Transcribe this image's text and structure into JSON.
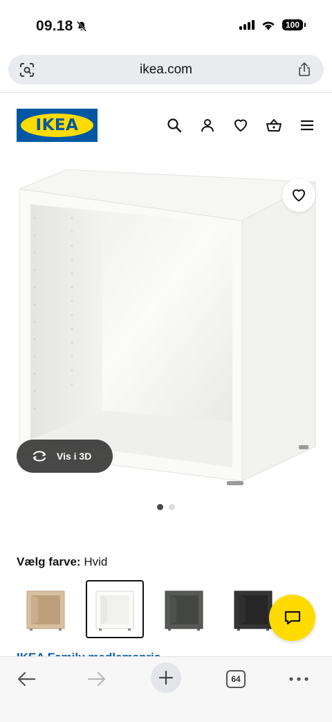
{
  "status": {
    "time": "09.18",
    "battery": "100"
  },
  "browser": {
    "url": "ikea.com",
    "tab_count": "64"
  },
  "header": {
    "logo_text": "IKEA"
  },
  "product": {
    "view_3d_label": "Vis i 3D"
  },
  "carousel": {
    "count": 2,
    "active_index": 0
  },
  "colour": {
    "label": "Vælg farve:",
    "value": "Hvid"
  },
  "swatches": [
    {
      "name": "white-stained-oak",
      "color": "#c9ad8c"
    },
    {
      "name": "white",
      "color": "#f4f4f2",
      "selected": true
    },
    {
      "name": "dark-grey",
      "color": "#4b4d4b"
    },
    {
      "name": "black-brown",
      "color": "#2b2b2b"
    }
  ],
  "peek_text": "IKEA Family medlemspris",
  "colors": {
    "ikea_blue": "#0058a3",
    "ikea_yellow": "#ffdb00"
  }
}
